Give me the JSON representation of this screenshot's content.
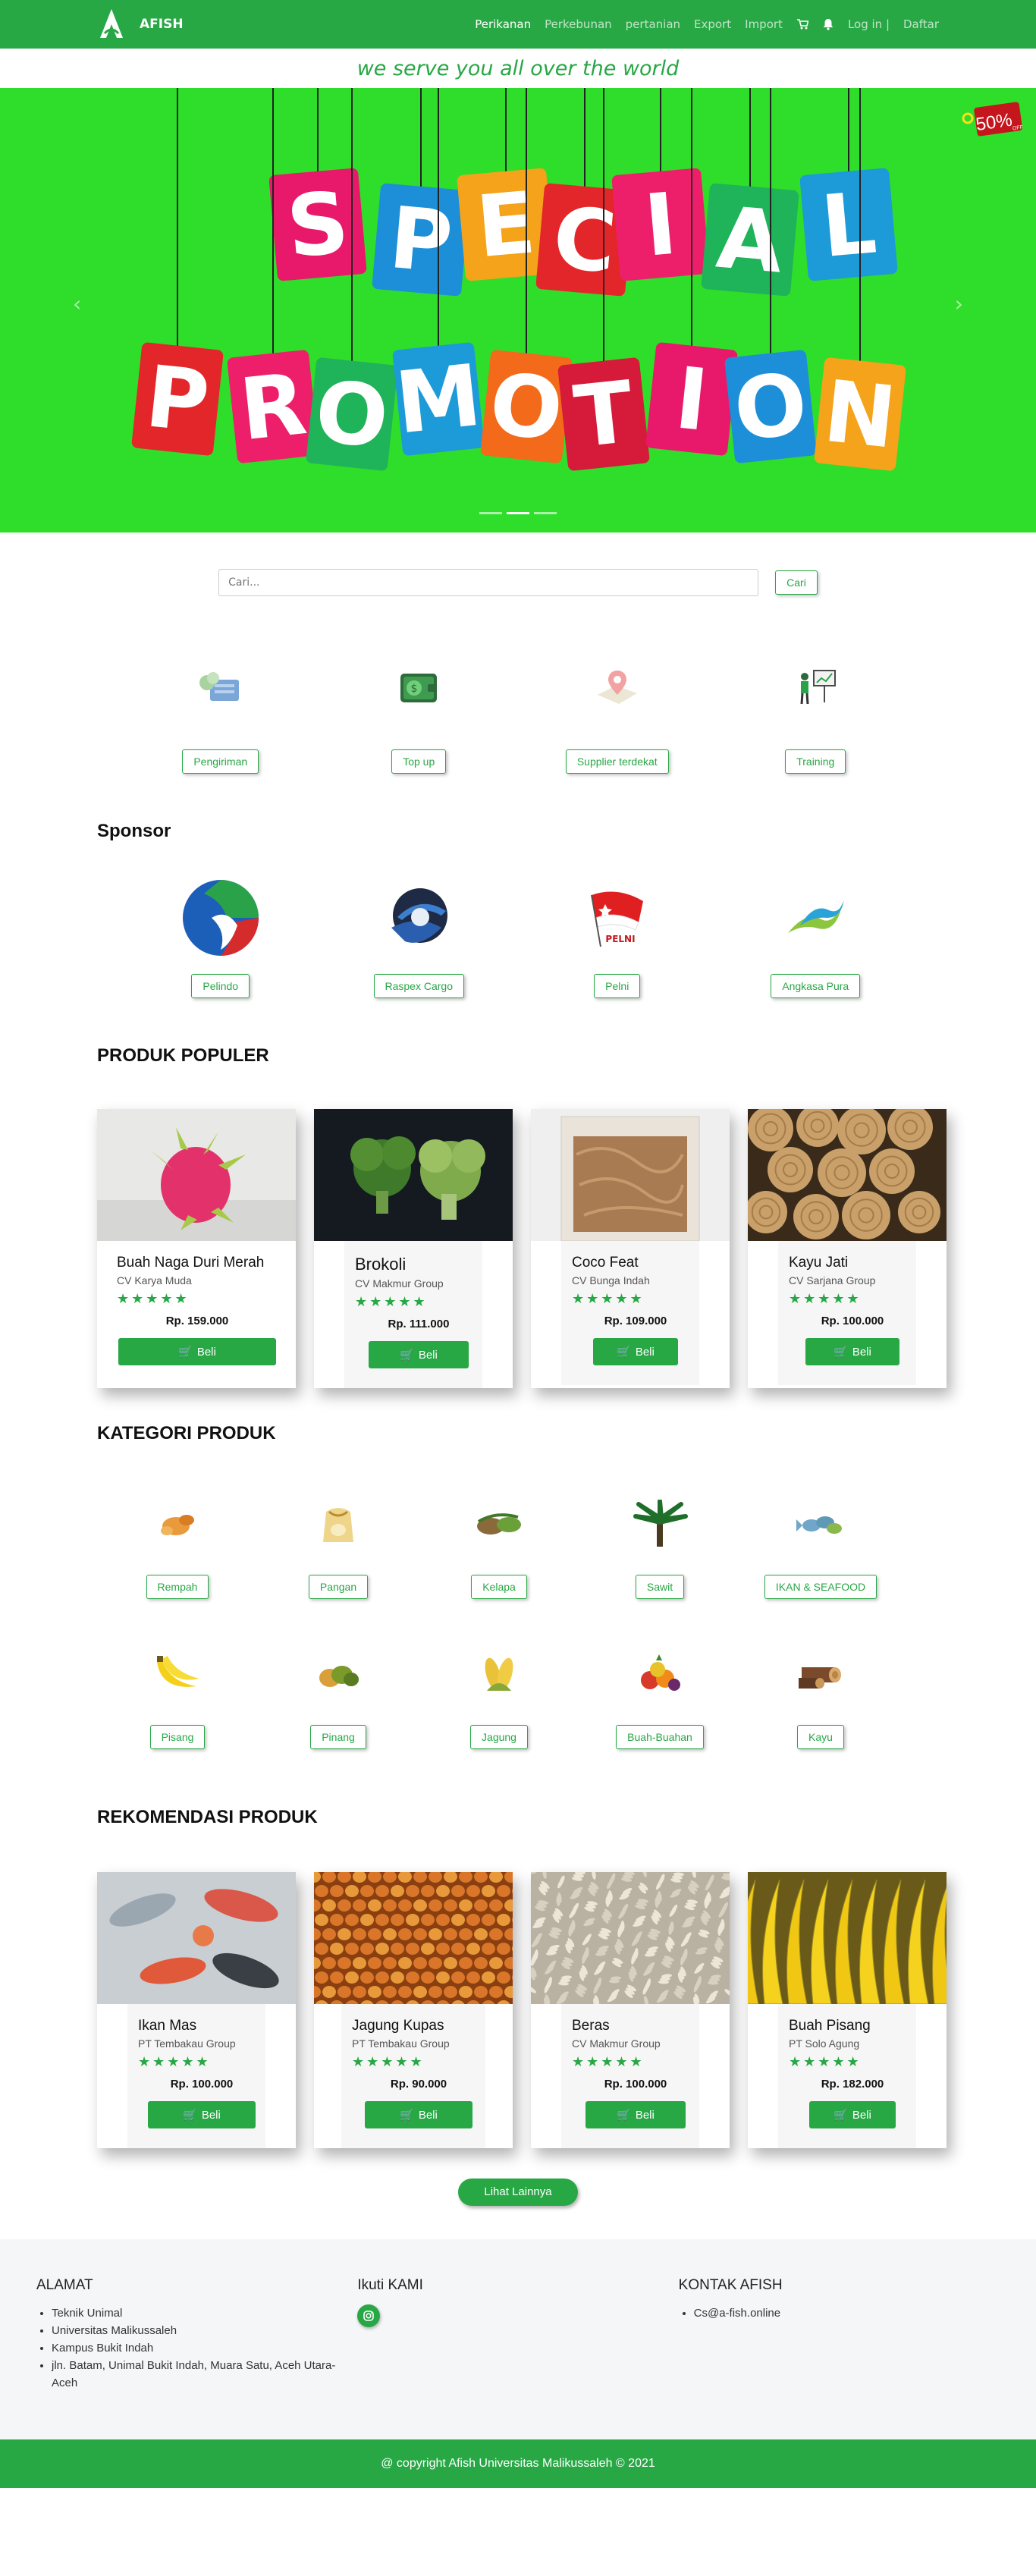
{
  "nav": {
    "brand": "AFISH",
    "links": [
      "Perikanan",
      "Perkebunan",
      "pertanian",
      "Export",
      "Import"
    ],
    "cart_icon": "cart-icon",
    "bell_icon": "bell-icon",
    "login": "Log in |",
    "register": "Daftar"
  },
  "tagline": "we serve you all over the world",
  "carousel": {
    "row1": [
      "S",
      "P",
      "E",
      "C",
      "I",
      "A",
      "L"
    ],
    "row2": [
      "P",
      "R",
      "O",
      "M",
      "O",
      "T",
      "I",
      "O",
      "N"
    ],
    "badge": "50%",
    "badge_sub": "OFF",
    "prev": "‹",
    "next": "›"
  },
  "search": {
    "placeholder": "Cari...",
    "button": "Cari"
  },
  "services": [
    "Pengiriman",
    "Top up",
    "Supplier terdekat",
    "Training"
  ],
  "sponsor": {
    "title": "Sponsor",
    "items": [
      "Pelindo",
      "Raspex Cargo",
      "Pelni",
      "Angkasa Pura"
    ],
    "pelni_logo_text": "PELNI"
  },
  "popular": {
    "title": "PRODUK POPULER",
    "products": [
      {
        "name": "Buah Naga Duri Merah",
        "seller": "CV Karya Muda",
        "price": "Rp. 159.000"
      },
      {
        "name": "Brokoli",
        "seller": "CV Makmur Group",
        "price": "Rp. 111.000"
      },
      {
        "name": "Coco Feat",
        "seller": "CV Bunga Indah",
        "price": "Rp. 109.000"
      },
      {
        "name": "Kayu Jati",
        "seller": "CV Sarjana Group",
        "price": "Rp. 100.000"
      }
    ]
  },
  "stars": "★★★★★",
  "buy_label": "Beli",
  "categories": {
    "title": "KATEGORI PRODUK",
    "row1": [
      "Rempah",
      "Pangan",
      "Kelapa",
      "Sawit",
      "IKAN & SEAFOOD"
    ],
    "row2": [
      "Pisang",
      "Pinang",
      "Jagung",
      "Buah-Buahan",
      "Kayu"
    ]
  },
  "recommend": {
    "title": "REKOMENDASI PRODUK",
    "products": [
      {
        "name": "Ikan Mas",
        "seller": "PT Tembakau Group",
        "price": "Rp. 100.000"
      },
      {
        "name": "Jagung Kupas",
        "seller": "PT Tembakau Group",
        "price": "Rp. 90.000"
      },
      {
        "name": "Beras",
        "seller": "CV Makmur Group",
        "price": "Rp. 100.000"
      },
      {
        "name": "Buah Pisang",
        "seller": "PT Solo Agung",
        "price": "Rp. 182.000"
      }
    ]
  },
  "more_button": "Lihat Lainnya",
  "footer": {
    "alamat_title": "ALAMAT",
    "alamat": [
      "Teknik Unimal",
      "Universitas Malikussaleh",
      "Kampus Bukit Indah",
      "jln. Batam, Unimal Bukit Indah, Muara Satu, Aceh Utara-Aceh"
    ],
    "follow_title": "Ikuti KAMI",
    "contact_title": "KONTAK AFISH",
    "contact": [
      "Cs@a-fish.online"
    ],
    "copyright": "@ copyright Afish Universitas Malikussaleh © 2021"
  },
  "colors": {
    "primary": "#28a745",
    "banner_bg": "#2ede2a"
  }
}
